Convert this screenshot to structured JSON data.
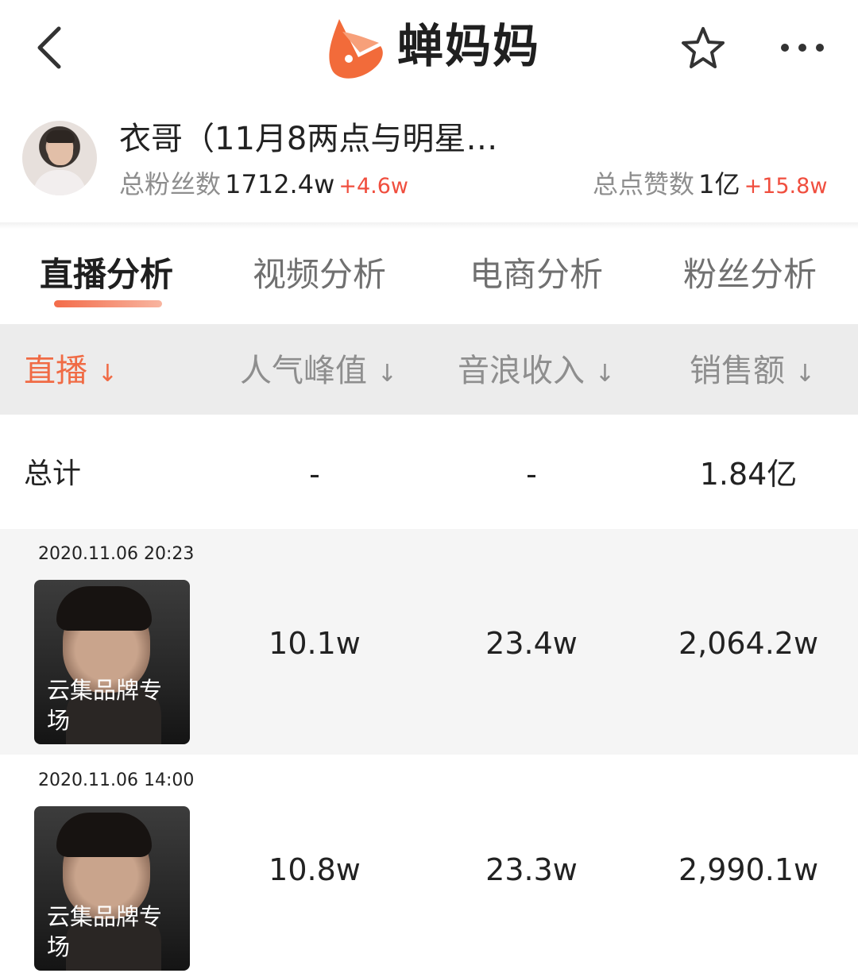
{
  "nav": {
    "app_name": "蝉妈妈",
    "back_icon": "chevron-left-icon",
    "favorite_icon": "star-icon",
    "more_icon": "more-dots-icon",
    "brand_color": "#F26B3A"
  },
  "profile": {
    "name": "衣哥（11月8两点与明星…",
    "fans_label": "总粉丝数",
    "fans_value": "1712.4w",
    "fans_delta": "+4.6w",
    "likes_label": "总点赞数",
    "likes_value": "1亿",
    "likes_delta": "+15.8w"
  },
  "tabs": [
    {
      "label": "直播分析",
      "active": true
    },
    {
      "label": "视频分析",
      "active": false
    },
    {
      "label": "电商分析",
      "active": false
    },
    {
      "label": "粉丝分析",
      "active": false
    }
  ],
  "table": {
    "headers": [
      "直播",
      "人气峰值",
      "音浪收入",
      "销售额"
    ],
    "sort_glyph": "↓",
    "total": {
      "label": "总计",
      "peak": "-",
      "income": "-",
      "sales": "1.84亿"
    },
    "rows": [
      {
        "date": "2020.11.06 20:23",
        "title_line1": "云集品牌专",
        "title_line2": "场",
        "peak": "10.1w",
        "income": "23.4w",
        "sales": "2,064.2w"
      },
      {
        "date": "2020.11.06 14:00",
        "title_line1": "云集品牌专",
        "title_line2": "场",
        "peak": "10.8w",
        "income": "23.3w",
        "sales": "2,990.1w"
      }
    ]
  }
}
